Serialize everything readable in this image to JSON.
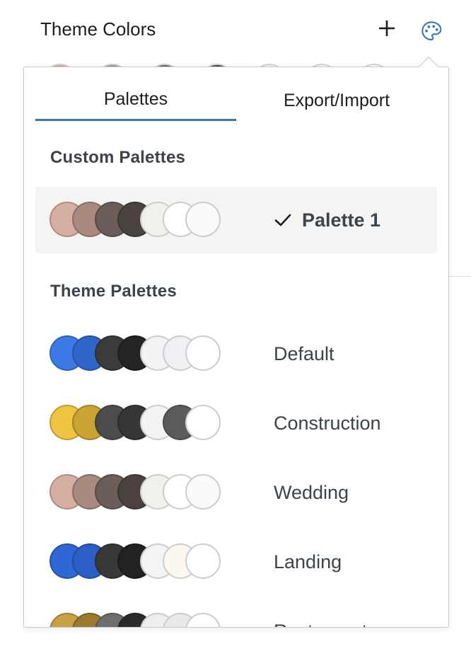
{
  "header": {
    "title": "Theme Colors"
  },
  "tabs": [
    {
      "label": "Palettes",
      "active": true
    },
    {
      "label": "Export/Import",
      "active": false
    }
  ],
  "sections": {
    "custom": "Custom Palettes",
    "theme": "Theme Palettes"
  },
  "custom_palettes": [
    {
      "name": "Palette 1",
      "selected": true,
      "colors": [
        "#d7aea2",
        "#a98a7f",
        "#6b5d59",
        "#4a423e",
        "#f1f0ea",
        "#ffffff",
        "#fafafa"
      ]
    }
  ],
  "theme_palettes": [
    {
      "name": "Default",
      "colors": [
        "#3b79e4",
        "#2f66c9",
        "#3b3b3b",
        "#242424",
        "#f2f3f5",
        "#eef0f3",
        "#ffffff"
      ]
    },
    {
      "name": "Construction",
      "colors": [
        "#eec443",
        "#cba333",
        "#4c4c4c",
        "#363636",
        "#f3f3f3",
        "#5b5b5b",
        "#ffffff"
      ]
    },
    {
      "name": "Wedding",
      "colors": [
        "#d7aea2",
        "#a98a7f",
        "#6b5d59",
        "#4a423e",
        "#f1f0ea",
        "#ffffff",
        "#fafafa"
      ]
    },
    {
      "name": "Landing",
      "colors": [
        "#2f67d4",
        "#2c5fc5",
        "#383838",
        "#222222",
        "#f2f4f6",
        "#fcf8ef",
        "#ffffff"
      ]
    },
    {
      "name": "Restaurant",
      "colors": [
        "#c9a045",
        "#9a7a2d",
        "#6e6e6e",
        "#2a2a2a",
        "#eeeeee",
        "#e9e9e9",
        "#ffffff"
      ]
    }
  ],
  "behind_swatch_colors": [
    "#c9a89c",
    "#a98a7f",
    "#6b5d59",
    "#4a423e",
    "#f1f0ea",
    "#f6f6f6",
    "#fafafa"
  ],
  "icons": {
    "add": "plus-icon",
    "palette": "palette-icon",
    "check": "check-icon"
  },
  "accent_color": "#3a78b2"
}
